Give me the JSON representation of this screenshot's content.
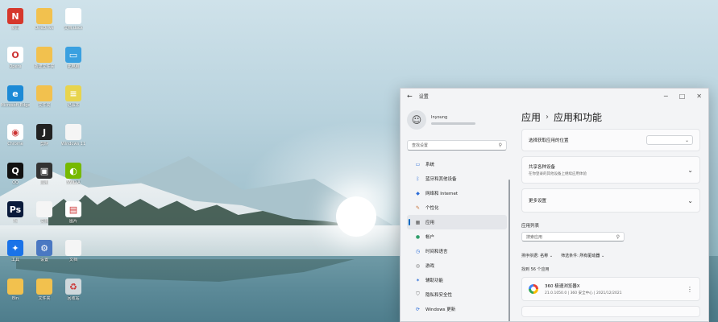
{
  "desktop": {
    "icons": [
      {
        "label": "新闻",
        "icon": "news-app-icon"
      },
      {
        "label": "OneDrive",
        "icon": "folder-icon"
      },
      {
        "label": "文档.docx",
        "icon": "document-icon"
      },
      {
        "label": "Opera",
        "icon": "opera-icon"
      },
      {
        "label": "新建文件夹",
        "icon": "folder-icon"
      },
      {
        "label": "此电脑",
        "icon": "monitor-icon"
      },
      {
        "label": "Microsoft Edge",
        "icon": "edge-icon"
      },
      {
        "label": "文件夹",
        "icon": "folder-icon"
      },
      {
        "label": "记事本",
        "icon": "notepad-icon"
      },
      {
        "label": "Chrome",
        "icon": "chrome-icon"
      },
      {
        "label": "剪映",
        "icon": "capcut-icon"
      },
      {
        "label": "Windows 11",
        "icon": "file-icon"
      },
      {
        "label": "QQ",
        "icon": "qq-icon"
      },
      {
        "label": "应用",
        "icon": "app-icon"
      },
      {
        "label": "NVIDIA",
        "icon": "nvidia-icon"
      },
      {
        "label": "Ps",
        "icon": "photoshop-icon"
      },
      {
        "label": "文档",
        "icon": "file-icon"
      },
      {
        "label": "图片",
        "icon": "image-icon"
      },
      {
        "label": "工具",
        "icon": "tool-icon"
      },
      {
        "label": "设置",
        "icon": "settings-icon"
      },
      {
        "label": "文档",
        "icon": "file-icon"
      },
      {
        "label": "Bin",
        "icon": "folder-icon"
      },
      {
        "label": "文件夹",
        "icon": "folder-icon"
      },
      {
        "label": "回收站",
        "icon": "recycle-bin-icon"
      }
    ]
  },
  "window": {
    "title": "设置",
    "back": "←",
    "controls": {
      "minimize": "─",
      "maximize": "□",
      "close": "✕"
    }
  },
  "sidebar": {
    "profile_name": "Inyoung",
    "search_placeholder": "查找设置",
    "items": [
      {
        "label": "系统",
        "icon": "system-icon",
        "color": "#2b6cd8"
      },
      {
        "label": "蓝牙和其他设备",
        "icon": "bluetooth-icon",
        "color": "#2b6cd8"
      },
      {
        "label": "网络和 Internet",
        "icon": "network-icon",
        "color": "#2b6cd8"
      },
      {
        "label": "个性化",
        "icon": "brush-icon",
        "color": "#c46a2e"
      },
      {
        "label": "应用",
        "icon": "apps-icon",
        "color": "#555555"
      },
      {
        "label": "帐户",
        "icon": "account-icon",
        "color": "#2f9e6a"
      },
      {
        "label": "时间和语言",
        "icon": "time-language-icon",
        "color": "#2b6cd8"
      },
      {
        "label": "游戏",
        "icon": "gaming-icon",
        "color": "#666666"
      },
      {
        "label": "辅助功能",
        "icon": "accessibility-icon",
        "color": "#2b6cd8"
      },
      {
        "label": "隐私和安全性",
        "icon": "shield-icon",
        "color": "#666666"
      },
      {
        "label": "Windows 更新",
        "icon": "update-icon",
        "color": "#2b6cd8"
      }
    ],
    "active_index": 4
  },
  "main": {
    "breadcrumb_parent": "应用",
    "breadcrumb_sep": "›",
    "breadcrumb_current": "应用和功能",
    "card1_label": "选择获取应用的位置",
    "card2_label": "共享各种设备",
    "card2_sub": "在你登录的其他设备上继续应用体验",
    "card3_label": "更多设置",
    "app_list_title": "应用列表",
    "app_search_placeholder": "搜索应用",
    "sort_label": "排序依据:",
    "sort_value": "名称",
    "filter_label": "筛选条件:",
    "filter_value": "所有驱动器",
    "found_text": "找到 56 个应用",
    "app1_name": "360 极速浏览器X",
    "app1_meta": "21.0.1050.0  |  360 安全中心  |  2021/12/2021"
  }
}
